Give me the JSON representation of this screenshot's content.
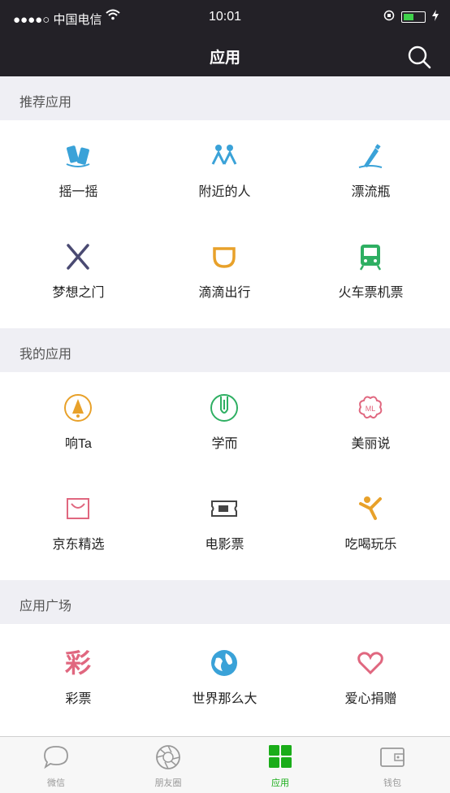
{
  "status_bar": {
    "carrier": "●●●●○ 中国电信",
    "time": "10:01",
    "battery_level": 0.55
  },
  "header": {
    "title": "应用"
  },
  "sections": {
    "recommended": {
      "title": "推荐应用",
      "items": [
        {
          "label": "摇一摇",
          "icon": "shake-phones-icon"
        },
        {
          "label": "附近的人",
          "icon": "people-nearby-icon"
        },
        {
          "label": "漂流瓶",
          "icon": "drift-bottle-icon"
        },
        {
          "label": "梦想之门",
          "icon": "dream-gate-icon"
        },
        {
          "label": "滴滴出行",
          "icon": "didi-icon"
        },
        {
          "label": "火车票机票",
          "icon": "train-icon"
        }
      ]
    },
    "mine": {
      "title": "我的应用",
      "items": [
        {
          "label": "响Ta",
          "icon": "bell-icon"
        },
        {
          "label": "学而",
          "icon": "pen-icon"
        },
        {
          "label": "美丽说",
          "icon": "flower-icon"
        },
        {
          "label": "京东精选",
          "icon": "shopping-bag-icon"
        },
        {
          "label": "电影票",
          "icon": "movie-ticket-icon"
        },
        {
          "label": "吃喝玩乐",
          "icon": "jumping-person-icon"
        }
      ]
    },
    "plaza": {
      "title": "应用广场",
      "items": [
        {
          "label": "彩票",
          "icon": "lottery-icon",
          "glyph": "彩"
        },
        {
          "label": "世界那么大",
          "icon": "globe-icon"
        },
        {
          "label": "爱心捐赠",
          "icon": "heart-icon"
        }
      ]
    }
  },
  "tabbar": {
    "tabs": [
      {
        "label": "微信",
        "icon": "chat-bubble-icon"
      },
      {
        "label": "朋友圈",
        "icon": "aperture-icon"
      },
      {
        "label": "应用",
        "icon": "apps-grid-icon",
        "active": true
      },
      {
        "label": "钱包",
        "icon": "wallet-icon"
      }
    ]
  },
  "colors": {
    "header_bg": "#232127",
    "section_bg": "#efeff4",
    "accent_green": "#1aad19",
    "icon_blue": "#3aa2d8",
    "icon_orange": "#e8a12a",
    "icon_pink": "#e0677f"
  }
}
